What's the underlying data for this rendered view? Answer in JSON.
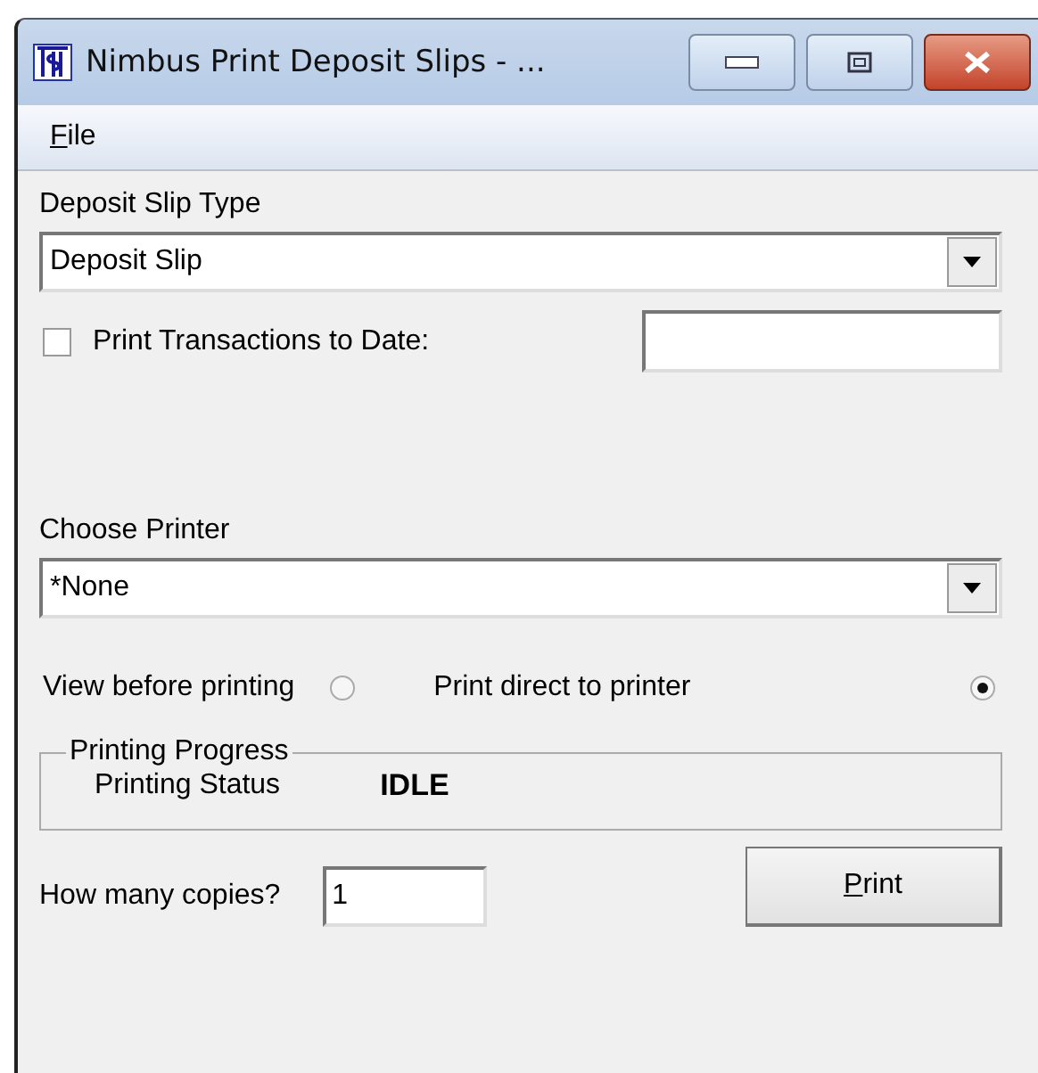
{
  "window": {
    "title": "Nimbus Print Deposit Slips - ..."
  },
  "menu": [
    {
      "label": "File"
    }
  ],
  "deposit_slip_type": {
    "label": "Deposit Slip Type",
    "value": "Deposit Slip"
  },
  "print_transactions": {
    "label": "Print Transactions to Date:",
    "checked": false
  },
  "printer": {
    "label": "Choose Printer",
    "value": "*None"
  },
  "output_options": [
    {
      "label": "View before printing",
      "selected": false
    },
    {
      "label": "Print direct to printer",
      "selected": true
    }
  ],
  "progress": {
    "title": "Printing Progress",
    "label": "Printing Status",
    "status": "IDLE"
  },
  "copies": {
    "label": "How many copies?",
    "value": "1"
  },
  "buttons": [
    {
      "label": "Print"
    }
  ]
}
